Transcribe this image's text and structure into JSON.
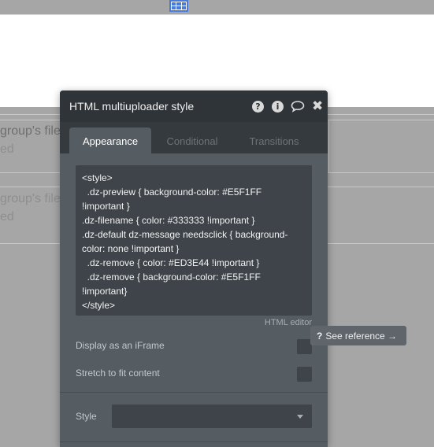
{
  "background": {
    "rows": [
      {
        "title": "group's file",
        "sub": "ed"
      },
      {
        "title": "group's file",
        "sub": "ed"
      }
    ]
  },
  "panel": {
    "title": "HTML multiuploader style",
    "header_icons": [
      "help-icon",
      "info-icon",
      "comment-icon",
      "close-icon"
    ],
    "tabs": [
      "Appearance",
      "Conditional",
      "Transitions"
    ],
    "active_tab": "Appearance",
    "code": "<style>\n  .dz-preview { background-color: #E5F1FF !important }\n.dz-filename { color: #333333 !important }\n.dz-default dz-message needsclick { background-color: none !important }\n  .dz-remove { color: #ED3E44 !important }\n  .dz-remove { background-color: #E5F1FF !important}\n</style>",
    "editor_link": "HTML editor",
    "options": [
      {
        "label": "Display as an iFrame",
        "checked": false
      },
      {
        "label": "Stretch to fit content",
        "checked": false
      }
    ],
    "style_label": "Style",
    "style_value": ""
  },
  "tooltip": {
    "text": "See reference →"
  },
  "colors": {
    "panel_bg": "#555c62",
    "header_bg": "#2f3438",
    "code_bg": "#3e4449",
    "accent_blue": "#4a7bd8"
  }
}
